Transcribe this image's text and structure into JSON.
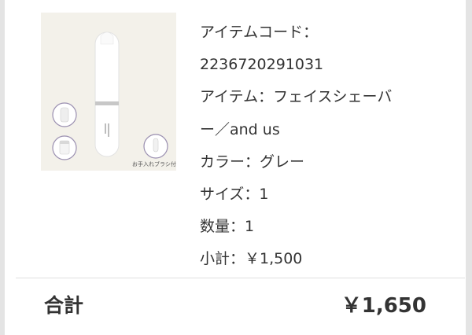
{
  "product": {
    "image_icon": "face-shaver-product-photo",
    "image_caption": "お手入れブラシ付",
    "details": [
      "アイテムコード：",
      "2236720291031",
      "アイテム：フェイスシェーバ",
      "ー／and us",
      "カラー：グレー",
      "サイズ：1",
      "数量：1",
      "小計：￥1,500"
    ]
  },
  "total": {
    "label": "合計",
    "value": "￥1,650"
  }
}
